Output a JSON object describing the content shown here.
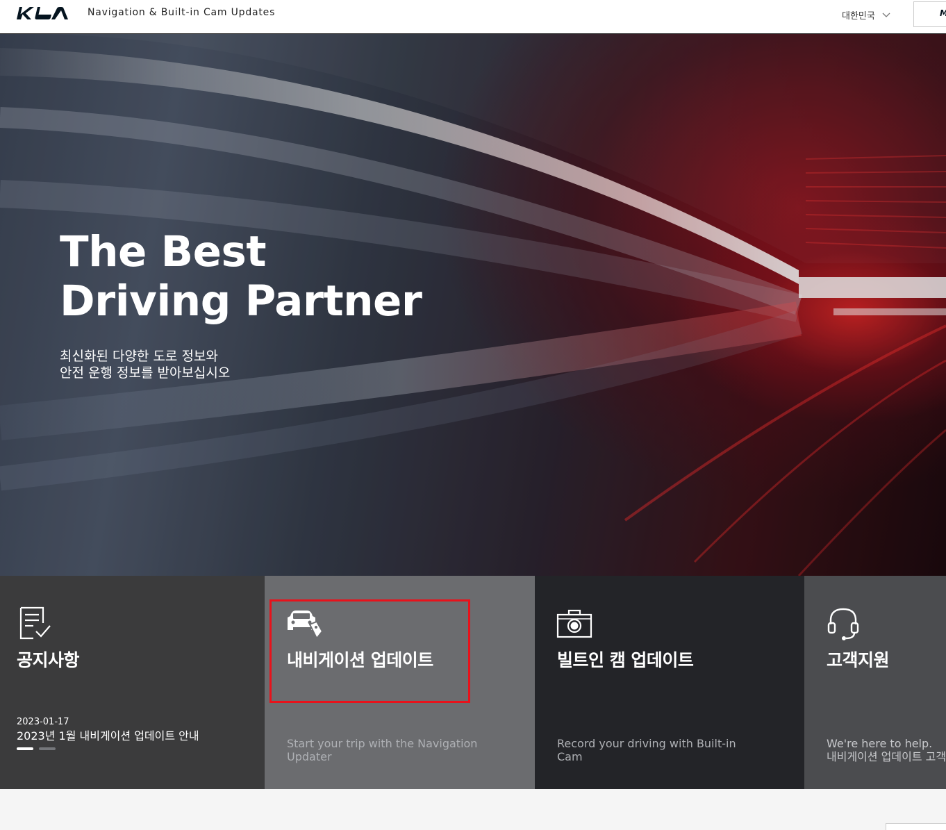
{
  "header": {
    "logo_text": "KIA",
    "site_title": "Navigation & Built-in Cam Updates",
    "language": "대한민국",
    "corner_button": "M"
  },
  "hero": {
    "title": "The Best\nDriving Partner",
    "subtitle": "최신화된 다양한 도로 정보와\n안전 운행 정보를 받아보십시오"
  },
  "cards": [
    {
      "title": "공지사항",
      "icon": "notice-checklist-icon",
      "notice_date": "2023-01-17",
      "notice_text": "2023년 1월 내비게이션 업데이트 안내"
    },
    {
      "title": "내비게이션 업데이트",
      "icon": "car-tag-icon",
      "description": "Start your trip with the Navigation\nUpdater"
    },
    {
      "title": "빌트인 캠 업데이트",
      "icon": "camera-icon",
      "description": "Record your driving with Built-in\nCam"
    },
    {
      "title": "고객지원",
      "icon": "headset-icon",
      "description": "We're here to help.\n내비게이션 업데이트 고객지원"
    }
  ],
  "colors": {
    "highlight_border": "#e8121b",
    "brand_dark": "#05141f"
  }
}
